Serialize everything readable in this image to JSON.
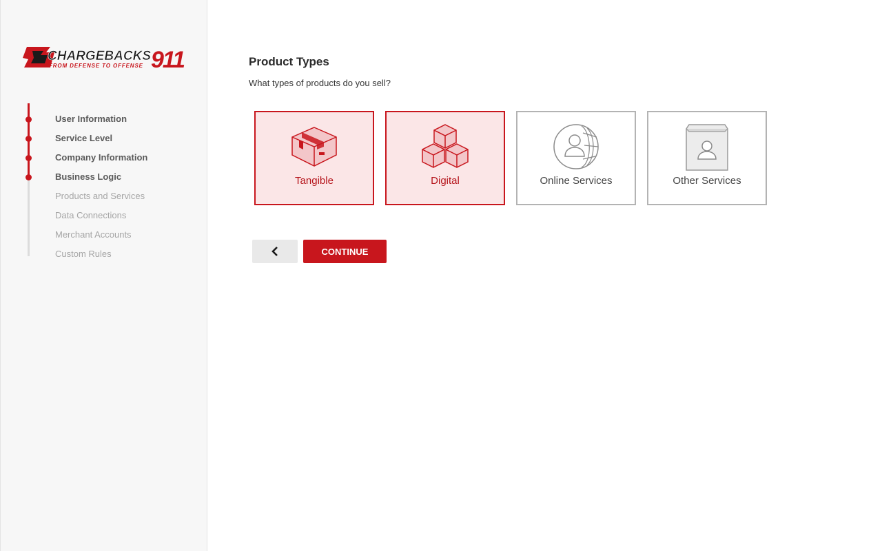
{
  "brand": {
    "logo_text": "CHARGEBACKS911",
    "tagline": "FROM DEFENSE TO OFFENSE",
    "accent": "#c8161d"
  },
  "steps": [
    {
      "label": "User Information",
      "done": true
    },
    {
      "label": "Service Level",
      "done": true
    },
    {
      "label": "Company Information",
      "done": true
    },
    {
      "label": "Business Logic",
      "done": true
    },
    {
      "label": "Products and Services",
      "done": false
    },
    {
      "label": "Data Connections",
      "done": false
    },
    {
      "label": "Merchant Accounts",
      "done": false
    },
    {
      "label": "Custom Rules",
      "done": false
    }
  ],
  "page": {
    "title": "Product Types",
    "subtitle": "What types of products do you sell?"
  },
  "options": [
    {
      "label": "Tangible",
      "icon": "box-icon",
      "selected": true
    },
    {
      "label": "Digital",
      "icon": "cubes-icon",
      "selected": true
    },
    {
      "label": "Online Services",
      "icon": "globe-person-icon",
      "selected": false
    },
    {
      "label": "Other Services",
      "icon": "bag-person-icon",
      "selected": false
    }
  ],
  "buttons": {
    "back_icon": "chevron-left-icon",
    "continue_label": "CONTINUE"
  }
}
